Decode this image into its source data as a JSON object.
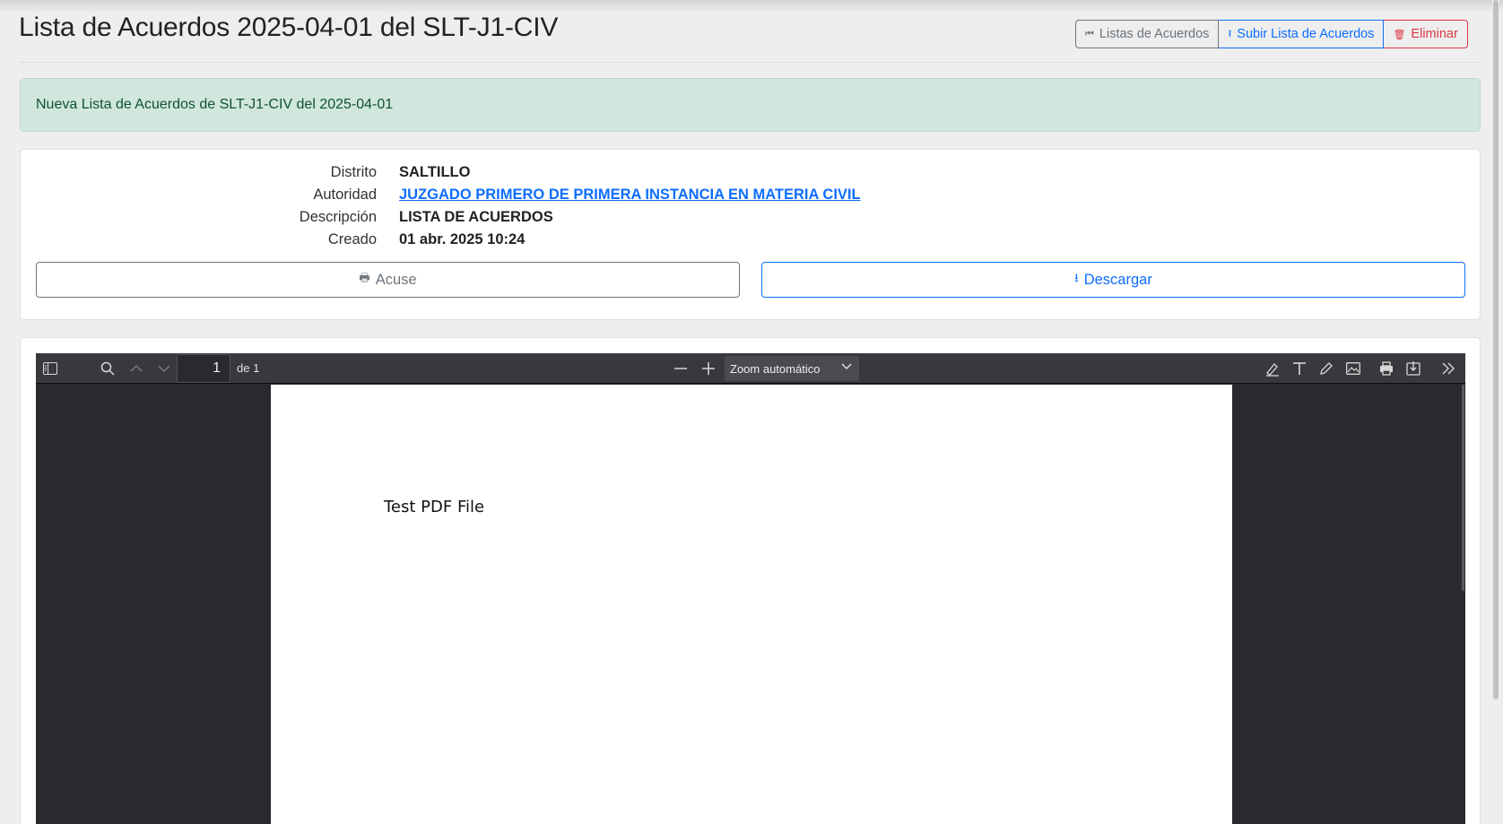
{
  "page": {
    "title": "Lista de Acuerdos 2025-04-01 del SLT-J1-CIV"
  },
  "actions": {
    "listas_label": "Listas de Acuerdos",
    "subir_label": "Subir Lista de Acuerdos",
    "eliminar_label": "Eliminar"
  },
  "alert": {
    "message": "Nueva Lista de Acuerdos de SLT-J1-CIV del 2025-04-01"
  },
  "details": {
    "distrito_label": "Distrito",
    "distrito_value": "SALTILLO",
    "autoridad_label": "Autoridad",
    "autoridad_value": "JUZGADO PRIMERO DE PRIMERA INSTANCIA EN MATERIA CIVIL",
    "descripcion_label": "Descripción",
    "descripcion_value": "LISTA DE ACUERDOS",
    "creado_label": "Creado",
    "creado_value": "01 abr. 2025 10:24"
  },
  "buttons": {
    "acuse_label": "Acuse",
    "descargar_label": "Descargar"
  },
  "pdf_viewer": {
    "page_number": "1",
    "page_of": "de 1",
    "zoom": "Zoom automático",
    "document_text": "Test PDF File"
  },
  "colors": {
    "primary": "#0d6efd",
    "secondary": "#6c757d",
    "danger": "#dc3545",
    "alert_bg": "#d1e7dd",
    "alert_text": "#0f5132",
    "viewer_bg": "#2a2a2e",
    "toolbar_bg": "#38383d"
  },
  "icons": {
    "listas": "fast-backward-icon",
    "subir": "upload-icon",
    "eliminar": "trash-icon",
    "acuse": "printer-icon",
    "descargar": "download-icon"
  }
}
